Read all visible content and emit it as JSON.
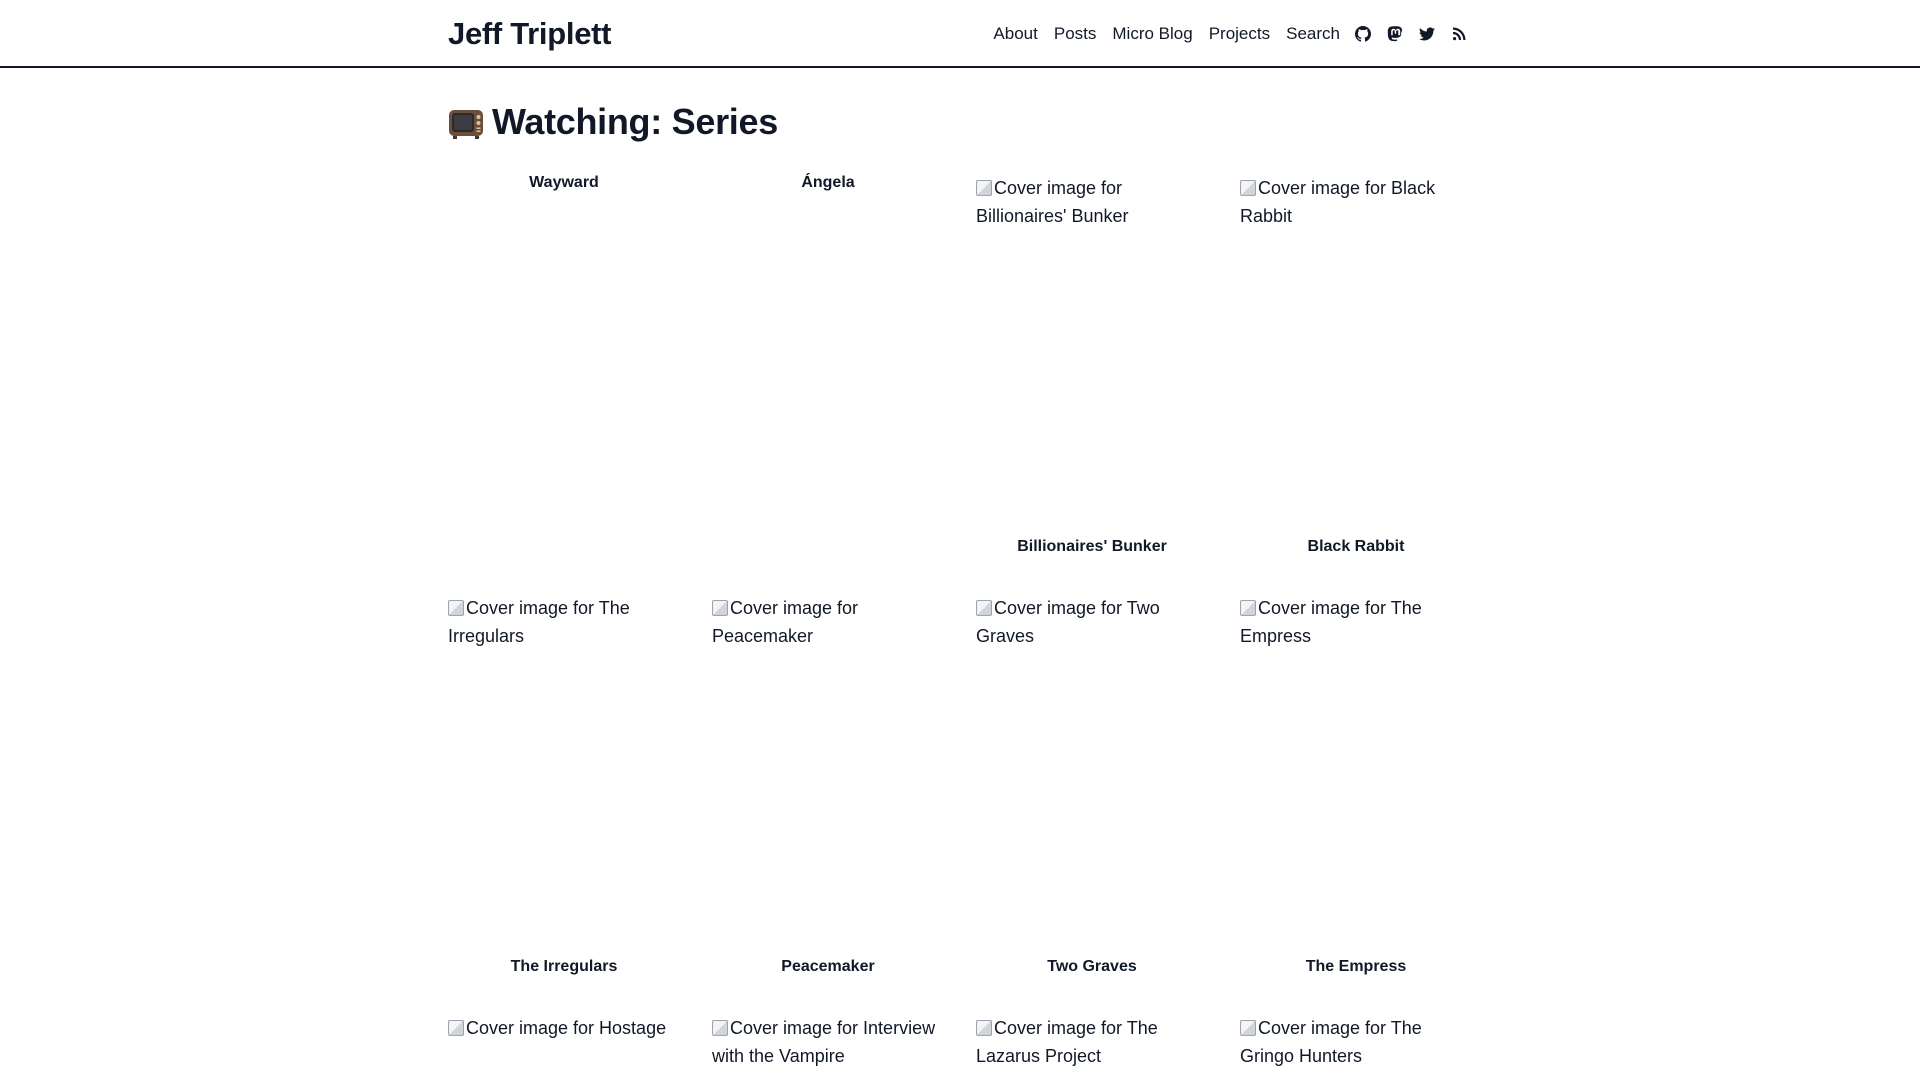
{
  "site": {
    "title": "Jeff Triplett"
  },
  "nav": {
    "items": [
      "About",
      "Posts",
      "Micro Blog",
      "Projects",
      "Search"
    ],
    "icons": [
      "github-icon",
      "mastodon-icon",
      "twitter-icon",
      "rss-icon"
    ]
  },
  "page": {
    "title": "Watching: Series",
    "title_icon": "television-icon"
  },
  "series": [
    {
      "title": "Wayward",
      "cover_alt": ""
    },
    {
      "title": "Ángela",
      "cover_alt": ""
    },
    {
      "title": "Billionaires' Bunker",
      "cover_alt": "Cover image for Billionaires' Bunker"
    },
    {
      "title": "Black Rabbit",
      "cover_alt": "Cover image for Black Rabbit"
    },
    {
      "title": "The Irregulars",
      "cover_alt": "Cover image for The Irregulars"
    },
    {
      "title": "Peacemaker",
      "cover_alt": "Cover image for Peacemaker"
    },
    {
      "title": "Two Graves",
      "cover_alt": "Cover image for Two Graves"
    },
    {
      "title": "The Empress",
      "cover_alt": "Cover image for The Empress"
    },
    {
      "title": "",
      "cover_alt": "Cover image for Hostage"
    },
    {
      "title": "",
      "cover_alt": "Cover image for Interview with the Vampire"
    },
    {
      "title": "",
      "cover_alt": "Cover image for The Lazarus Project"
    },
    {
      "title": "",
      "cover_alt": "Cover image for The Gringo Hunters"
    }
  ]
}
